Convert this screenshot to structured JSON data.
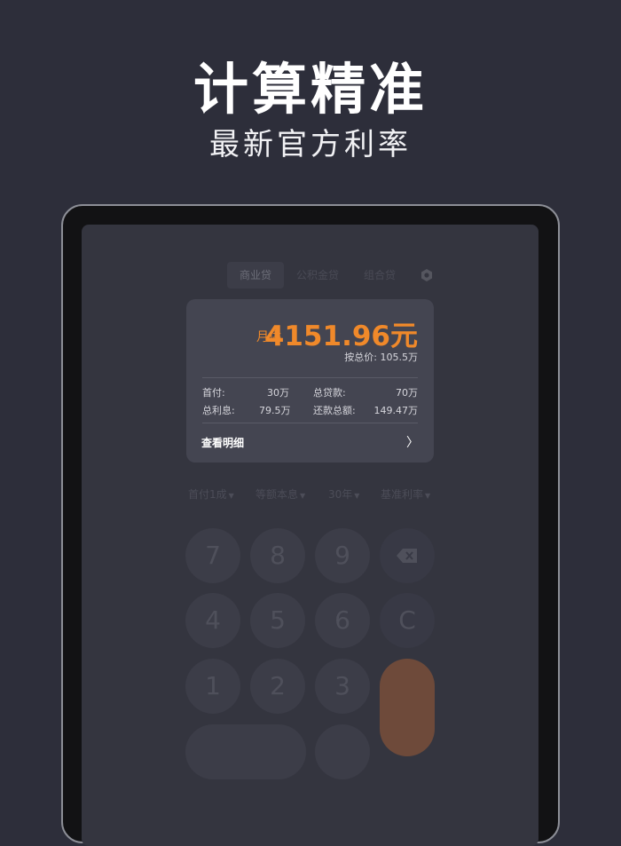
{
  "promo": {
    "headline": "计算精准",
    "subheadline": "最新官方利率"
  },
  "tabs": [
    {
      "label": "商业贷",
      "active": true
    },
    {
      "label": "公积金贷",
      "active": false
    },
    {
      "label": "组合贷",
      "active": false
    }
  ],
  "settings_icon": "gear-icon",
  "result": {
    "monthly_label": "月供",
    "monthly_value": "4151.96元",
    "total_price_label": "按总价:",
    "total_price_value": "105.5万",
    "down_payment_label": "首付:",
    "down_payment_value": "30万",
    "loan_total_label": "总贷款:",
    "loan_total_value": "70万",
    "interest_label": "总利息:",
    "interest_value": "79.5万",
    "repay_total_label": "还款总额:",
    "repay_total_value": "149.47万",
    "detail_label": "查看明细",
    "detail_chevron": "〉"
  },
  "options": [
    "首付1成",
    "等额本息",
    "30年",
    "基准利率"
  ],
  "keypad": {
    "keys": [
      "7",
      "8",
      "9",
      "4",
      "5",
      "6",
      "1",
      "2",
      "3"
    ],
    "backspace_icon": "backspace-icon",
    "clear": "C"
  },
  "colors": {
    "background": "#2d2e3a",
    "accent": "#f0892a",
    "card": "#444551"
  }
}
